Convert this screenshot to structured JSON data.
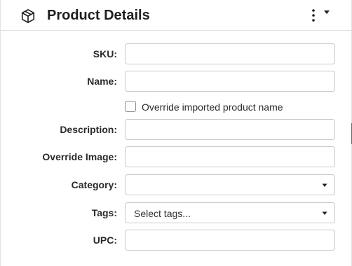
{
  "header": {
    "title": "Product Details",
    "icon": "box-icon",
    "menu_icon": "kebab-menu-icon",
    "dropdown_icon": "caret-down-icon"
  },
  "form": {
    "sku": {
      "label": "SKU:",
      "value": ""
    },
    "name": {
      "label": "Name:",
      "value": ""
    },
    "override_name": {
      "label": "Override imported product name",
      "checked": false
    },
    "description": {
      "label": "Description:",
      "value": ""
    },
    "override_image": {
      "label": "Override Image:",
      "value": ""
    },
    "category": {
      "label": "Category:",
      "selected": ""
    },
    "tags": {
      "label": "Tags:",
      "placeholder": "Select tags..."
    },
    "upc": {
      "label": "UPC:",
      "value": ""
    }
  },
  "colors": {
    "accent": "#3c6bb5",
    "border": "#c9c9c9",
    "text": "#1f1f1f"
  }
}
